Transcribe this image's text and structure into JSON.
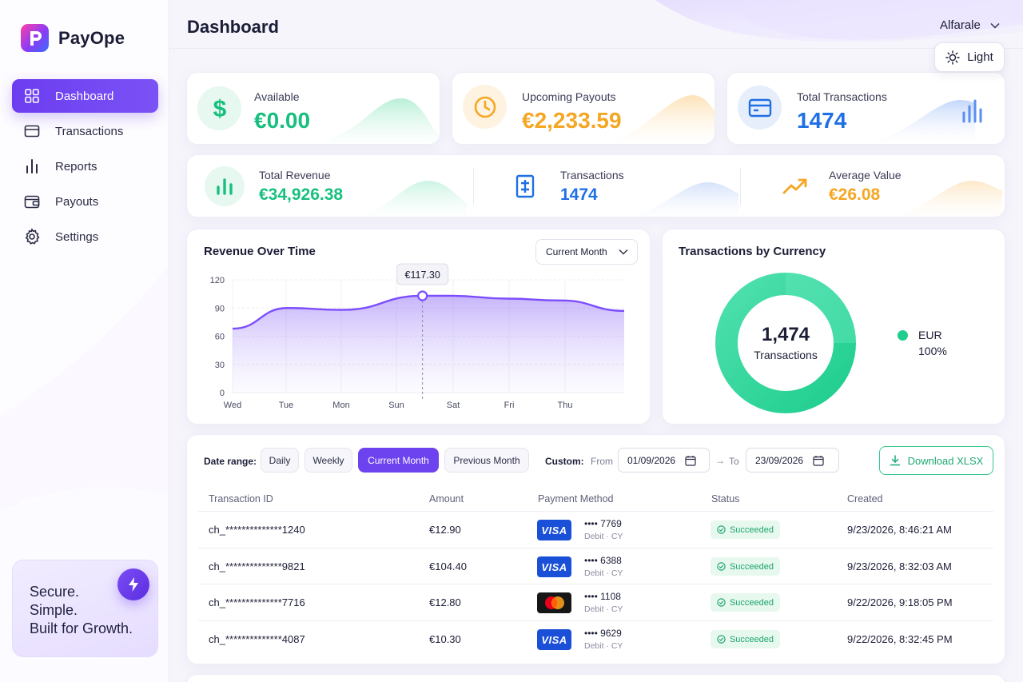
{
  "brand": {
    "name": "PayOpe"
  },
  "sidebar": {
    "items": [
      {
        "label": "Dashboard",
        "icon": "grid-icon",
        "active": true
      },
      {
        "label": "Transactions",
        "icon": "card-icon"
      },
      {
        "label": "Reports",
        "icon": "bar-chart-icon"
      },
      {
        "label": "Payouts",
        "icon": "wallet-icon"
      },
      {
        "label": "Settings",
        "icon": "gear-icon"
      }
    ],
    "promo": {
      "line1": "Secure.",
      "line2": "Simple.",
      "line3": "Built for Growth.",
      "icon": "bolt-icon"
    }
  },
  "header": {
    "title": "Dashboard",
    "user": "Alfarale",
    "theme_label": "Light"
  },
  "stats_top": [
    {
      "label": "Available",
      "value": "€0.00",
      "color": "#18c07f",
      "icon": "dollar-icon"
    },
    {
      "label": "Upcoming Payouts",
      "value": "€2,233.59",
      "color": "#f5a623",
      "icon": "clock-icon"
    },
    {
      "label": "Total Transactions",
      "value": "1474",
      "color": "#1f6fe5",
      "icon": "card-icon"
    }
  ],
  "stats_second": [
    {
      "label": "Total Revenue",
      "value": "€34,926.38",
      "color": "#18c07f",
      "icon": "bar-chart-icon"
    },
    {
      "label": "Transactions",
      "value": "1474",
      "color": "#1f6fe5",
      "icon": "receipt-icon"
    },
    {
      "label": "Average Value",
      "value": "€26.08",
      "color": "#f5a623",
      "icon": "trend-up-icon"
    }
  ],
  "revenue": {
    "title": "Revenue Over Time",
    "period_select": "Current Month",
    "tooltip": "€117.30"
  },
  "chart_data": {
    "type": "area",
    "title": "Revenue Over Time",
    "x": [
      "Wed",
      "Tue",
      "Mon",
      "Sun",
      "Sat",
      "Fri",
      "Thu"
    ],
    "y_ticks": [
      0,
      30,
      60,
      90,
      120
    ],
    "ylim": [
      0,
      120
    ],
    "series": [
      {
        "values": [
          68,
          90,
          88,
          103,
          103,
          100,
          98,
          87
        ],
        "x_fraction": [
          0,
          0.14,
          0.28,
          0.485,
          0.56,
          0.7,
          0.84,
          1
        ]
      }
    ],
    "highlight": {
      "x": "Sun",
      "value": 117.3
    },
    "grid": true,
    "color": "#7c4dff"
  },
  "currency_chart": {
    "title": "Transactions by Currency",
    "center_value": "1,474",
    "center_label": "Transactions",
    "legend": [
      {
        "name": "EUR",
        "percent": "100%",
        "color": "#1fce8e"
      }
    ]
  },
  "filters": {
    "label": "Date range:",
    "chips": [
      "Daily",
      "Weekly",
      "Current Month",
      "Previous Month"
    ],
    "active_chip": "Current Month",
    "custom_label": "Custom:",
    "from_label": "From",
    "from_value": "01/09/2026",
    "arrow": "→",
    "to_label": "To",
    "to_value": "23/09/2026",
    "download": "Download XLSX"
  },
  "table": {
    "columns": [
      "Transaction ID",
      "Amount",
      "Payment Method",
      "Status",
      "Created"
    ],
    "rows": [
      {
        "id": "ch_**************1240",
        "amount": "€12.90",
        "brand": "VISA",
        "last4": "•••• 7769",
        "sub": "Debit · CY",
        "status": "Succeeded",
        "created": "9/23/2026, 8:46:21 AM"
      },
      {
        "id": "ch_**************9821",
        "amount": "€104.40",
        "brand": "VISA",
        "last4": "•••• 6388",
        "sub": "Debit · CY",
        "status": "Succeeded",
        "created": "9/23/2026, 8:32:03 AM"
      },
      {
        "id": "ch_**************7716",
        "amount": "€12.80",
        "brand": "MASTERCARD",
        "last4": "•••• 1108",
        "sub": "Debit · CY",
        "status": "Succeeded",
        "created": "9/22/2026, 9:18:05 PM"
      },
      {
        "id": "ch_**************4087",
        "amount": "€10.30",
        "brand": "VISA",
        "last4": "•••• 9629",
        "sub": "Debit · CY",
        "status": "Succeeded",
        "created": "9/22/2026, 8:32:45 PM"
      }
    ]
  }
}
